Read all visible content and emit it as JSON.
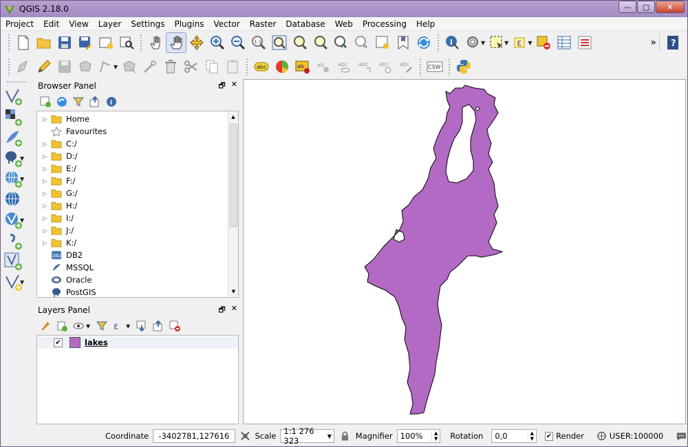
{
  "window": {
    "title": "QGIS 2.18.0"
  },
  "menu": [
    "Project",
    "Edit",
    "View",
    "Layer",
    "Settings",
    "Plugins",
    "Vector",
    "Raster",
    "Database",
    "Web",
    "Processing",
    "Help"
  ],
  "browser_panel": {
    "title": "Browser Panel",
    "items": [
      {
        "label": "Home",
        "icon": "folder-icon",
        "expandable": true
      },
      {
        "label": "Favourites",
        "icon": "star-icon",
        "expandable": false
      },
      {
        "label": "C:/",
        "icon": "folder-icon",
        "expandable": true
      },
      {
        "label": "D:/",
        "icon": "folder-icon",
        "expandable": true
      },
      {
        "label": "E:/",
        "icon": "folder-icon",
        "expandable": true
      },
      {
        "label": "F:/",
        "icon": "folder-icon",
        "expandable": true
      },
      {
        "label": "G:/",
        "icon": "folder-icon",
        "expandable": true
      },
      {
        "label": "H:/",
        "icon": "folder-icon",
        "expandable": true
      },
      {
        "label": "I:/",
        "icon": "folder-icon",
        "expandable": true
      },
      {
        "label": "J:/",
        "icon": "folder-icon",
        "expandable": true
      },
      {
        "label": "K:/",
        "icon": "folder-icon",
        "expandable": true
      },
      {
        "label": "DB2",
        "icon": "db2-icon",
        "expandable": false
      },
      {
        "label": "MSSQL",
        "icon": "mssql-icon",
        "expandable": false
      },
      {
        "label": "Oracle",
        "icon": "oracle-icon",
        "expandable": false
      },
      {
        "label": "PostGIS",
        "icon": "postgis-icon",
        "expandable": false
      }
    ]
  },
  "layers_panel": {
    "title": "Layers Panel",
    "layers": [
      {
        "name": "lakes",
        "checked": true,
        "color": "#b36ac4"
      }
    ]
  },
  "map": {
    "fill_color": "#b36ac4",
    "outline_color": "#000000"
  },
  "status": {
    "coordinate_label": "Coordinate",
    "coordinate_value": "-3402781,127616",
    "scale_label": "Scale",
    "scale_value": "1:1 276 323",
    "magnifier_label": "Magnifier",
    "magnifier_value": "100%",
    "rotation_label": "Rotation",
    "rotation_value": "0,0",
    "render_label": "Render",
    "crs_label": "USER:100000"
  }
}
